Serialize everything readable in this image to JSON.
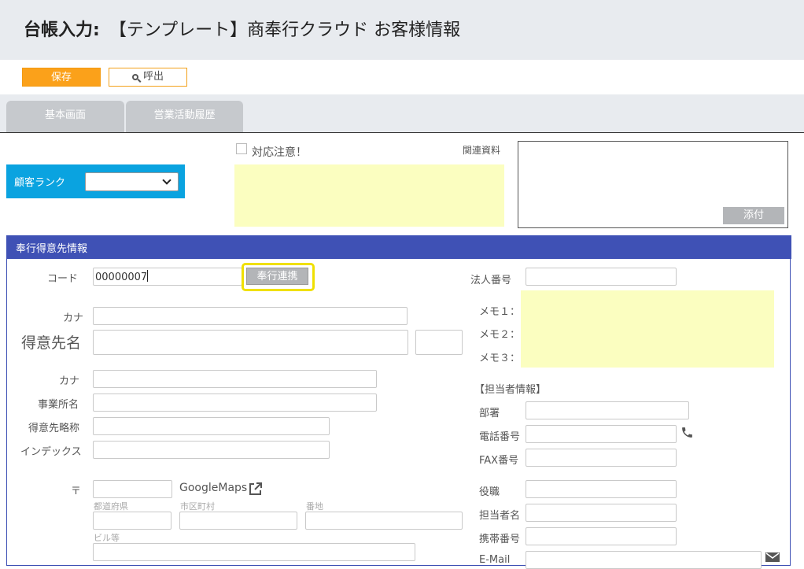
{
  "header": {
    "title_prefix": "台帳入力:",
    "title": "【テンプレート】商奉行クラウド お客様情報"
  },
  "toolbar": {
    "save_label": "保存",
    "call_label": "呼出"
  },
  "tabs": [
    {
      "label": "基本画面"
    },
    {
      "label": "営業活動履歴"
    }
  ],
  "rank": {
    "label": "顧客ランク",
    "value": ""
  },
  "caution": {
    "label": "対応注意！",
    "checked": false
  },
  "related": {
    "label": "関連資料",
    "attach_label": "添付"
  },
  "section": {
    "title": "奉行得意先情報"
  },
  "form": {
    "code_label": "コード",
    "code_value": "00000007",
    "link_button": "奉行連携",
    "kana1_label": "カナ",
    "customer_name_label": "得意先名",
    "kana2_label": "カナ",
    "office_label": "事業所名",
    "short_name_label": "得意先略称",
    "index_label": "インデックス",
    "postal_label": "〒",
    "googlemaps_label": "GoogleMaps",
    "prefecture_label": "都道府県",
    "city_label": "市区町村",
    "address_label": "番地",
    "building_label": "ビル等"
  },
  "right": {
    "corp_number_label": "法人番号",
    "memo1_label": "メモ１：",
    "memo2_label": "メモ２：",
    "memo3_label": "メモ３：",
    "contact_header": "【担当者情報】",
    "dept_label": "部署",
    "phone_label": "電話番号",
    "fax_label": "FAX番号",
    "position_label": "役職",
    "person_label": "担当者名",
    "mobile_label": "携帯番号",
    "email_label": "E-Mail"
  }
}
